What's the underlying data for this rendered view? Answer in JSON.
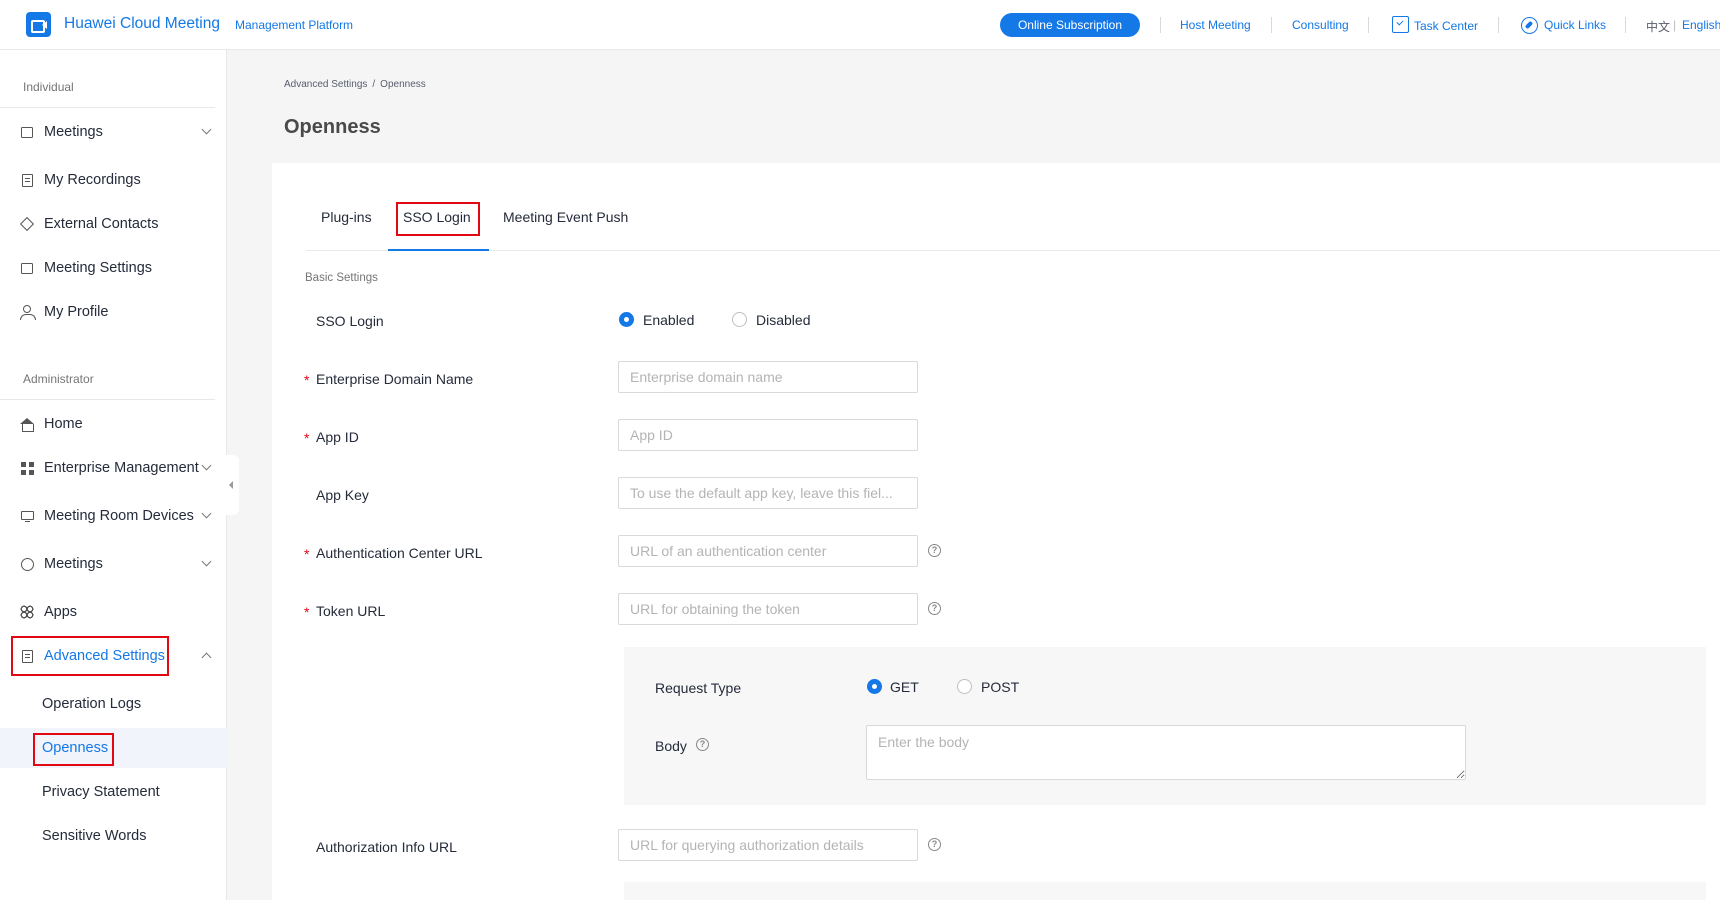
{
  "header": {
    "brand": "Huawei Cloud Meeting",
    "brand_sub": "Management Platform",
    "subscribe": "Online Subscription",
    "links": [
      "Host Meeting",
      "Consulting",
      "Task Center",
      "Quick Links"
    ],
    "lang_zh": "中文",
    "lang_sep": "|",
    "lang_en": "English"
  },
  "sidebar": {
    "individual_title": "Individual",
    "individual": [
      "Meetings",
      "My Recordings",
      "External Contacts",
      "Meeting Settings",
      "My Profile"
    ],
    "admin_title": "Administrator",
    "admin": [
      "Home",
      "Enterprise Management",
      "Meeting Room Devices",
      "Meetings",
      "Apps",
      "Advanced Settings"
    ],
    "advanced_sub": [
      "Operation Logs",
      "Openness",
      "Privacy Statement",
      "Sensitive Words"
    ]
  },
  "main": {
    "breadcrumb": [
      "Advanced Settings",
      "/",
      "Openness"
    ],
    "title": "Openness",
    "tabs": [
      "Plug-ins",
      "SSO Login",
      "Meeting Event Push"
    ],
    "group_title": "Basic Settings",
    "sso": {
      "label": "SSO Login",
      "enabled": "Enabled",
      "disabled": "Disabled"
    },
    "fields": {
      "domain": {
        "label": "Enterprise Domain Name",
        "placeholder": "Enterprise domain name",
        "required": "*"
      },
      "app_id": {
        "label": "App ID",
        "placeholder": "App ID",
        "required": "*"
      },
      "app_key": {
        "label": "App Key",
        "placeholder": "To use the default app key, leave this fiel..."
      },
      "auth_url": {
        "label": "Authentication Center URL",
        "placeholder": "URL of an authentication center",
        "required": "*"
      },
      "token_url": {
        "label": "Token URL",
        "placeholder": "URL for obtaining the token",
        "required": "*"
      },
      "authz_url": {
        "label": "Authorization Info URL",
        "placeholder": "URL for querying authorization details"
      }
    },
    "request": {
      "label": "Request Type",
      "get": "GET",
      "post": "POST",
      "body_label": "Body",
      "body_placeholder": "Enter the body"
    },
    "help_glyph": "?"
  },
  "colors": {
    "accent": "#1478e6",
    "highlight_box": "#e30613"
  }
}
